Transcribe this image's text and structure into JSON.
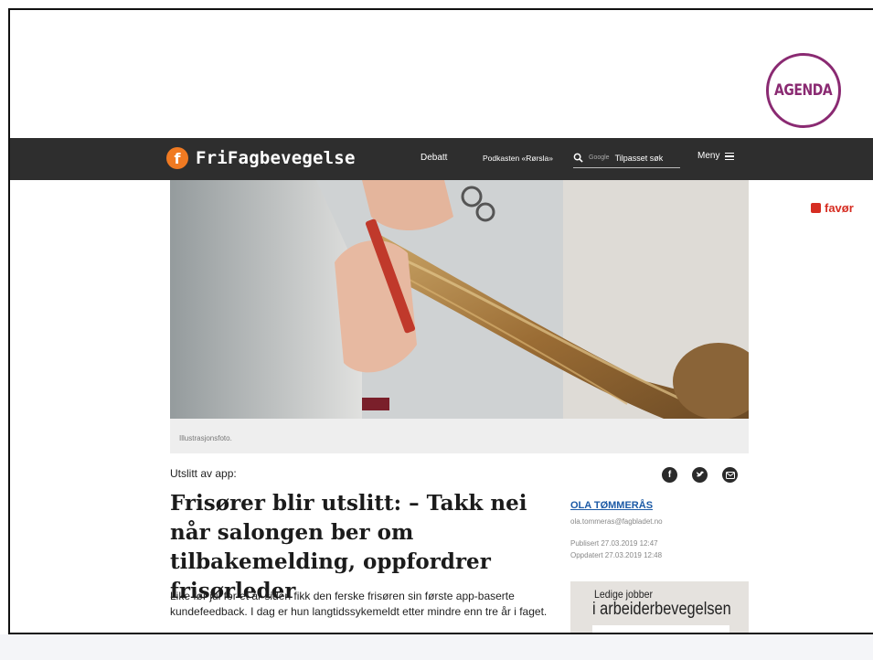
{
  "slide_badge": {
    "label": "AGENDA",
    "color": "#8a2a72"
  },
  "site": {
    "name": "FriFagbevegelse",
    "logo_color": "#f07a22",
    "nav_links": [
      "Debatt",
      "Podkasten «Rørsla»"
    ],
    "search": {
      "provider": "Google",
      "placeholder": "Tilpasset søk"
    },
    "menu_label": "Meny"
  },
  "partner": {
    "name": "favør",
    "color": "#d62d22"
  },
  "article": {
    "image_caption": "Illustrasjonsfoto.",
    "kicker": "Utslitt av app:",
    "headline": "Frisører blir utslitt: – Takk nei når salongen ber om tilbakemelding, oppfordrer frisørleder",
    "lead": "Like før jul for et år siden fikk den ferske frisøren sin første app-baserte kundefeedback. I dag er hun langtidssykemeldt etter mindre enn tre år i faget.",
    "author": "OLA TØMMERÅS",
    "author_email": "ola.tommeras@fagbladet.no",
    "published": "Publisert 27.03.2019 12:47",
    "updated": "Oppdatert 27.03.2019 12:48",
    "share_icons": [
      "facebook-icon",
      "twitter-icon",
      "email-icon"
    ]
  },
  "jobs_box": {
    "line1": "Ledige jobber",
    "line2": "i arbeiderbevegelsen"
  }
}
